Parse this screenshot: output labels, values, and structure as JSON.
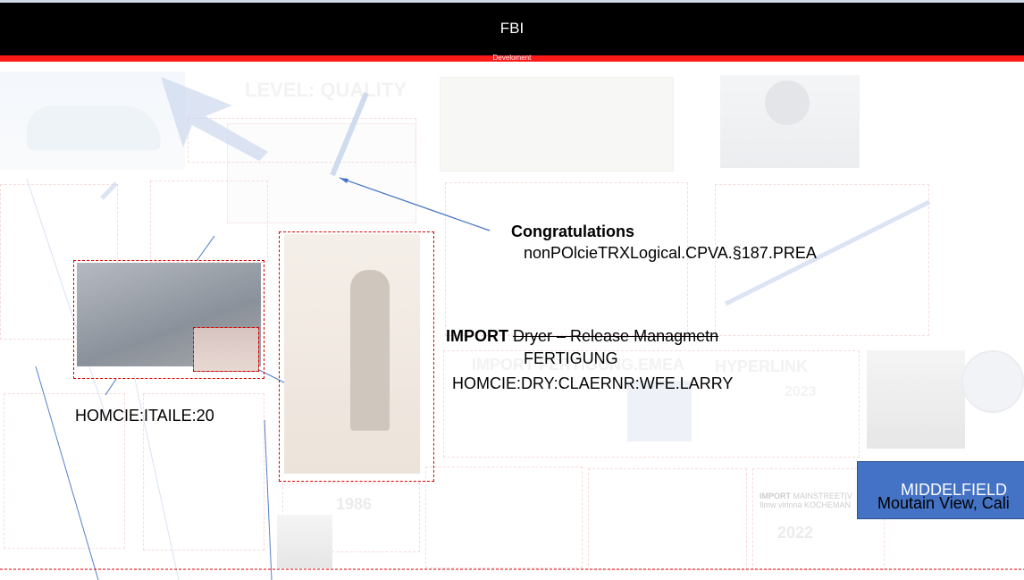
{
  "header": {
    "title": "FBI",
    "subtitle": "Develoment"
  },
  "background": {
    "level_label": "LEVEL: QUALITY",
    "import_label": "IMPORT",
    "import_rest": "FERTIGUNG.EMEA",
    "year_a": "1986",
    "year_b": "2022",
    "small_import": "IMPORT",
    "small_import_rest": "MAINSTREET|V",
    "small_import_line2": "Ilmw virinna KOCHEMAN",
    "ghost_mid": "HYPERLINK",
    "ghost_mid2": "2023"
  },
  "callout": {
    "title": "Congratulations",
    "subtitle": "nonPOlcieTRXLogical.CPVA.§187.PREA"
  },
  "import_block": {
    "label": "IMPORT",
    "struck_text": "Dryer – Release Managmetn",
    "line2": "FERTIGUNG",
    "line3": "HOMCIE:DRY:CLAERNR:WFE.LARRY"
  },
  "side_label": "HOMCIE:ITAILE:20",
  "location_box": {
    "title": "MIDDELFIELD",
    "subtitle": "Moutain View, Cali"
  }
}
